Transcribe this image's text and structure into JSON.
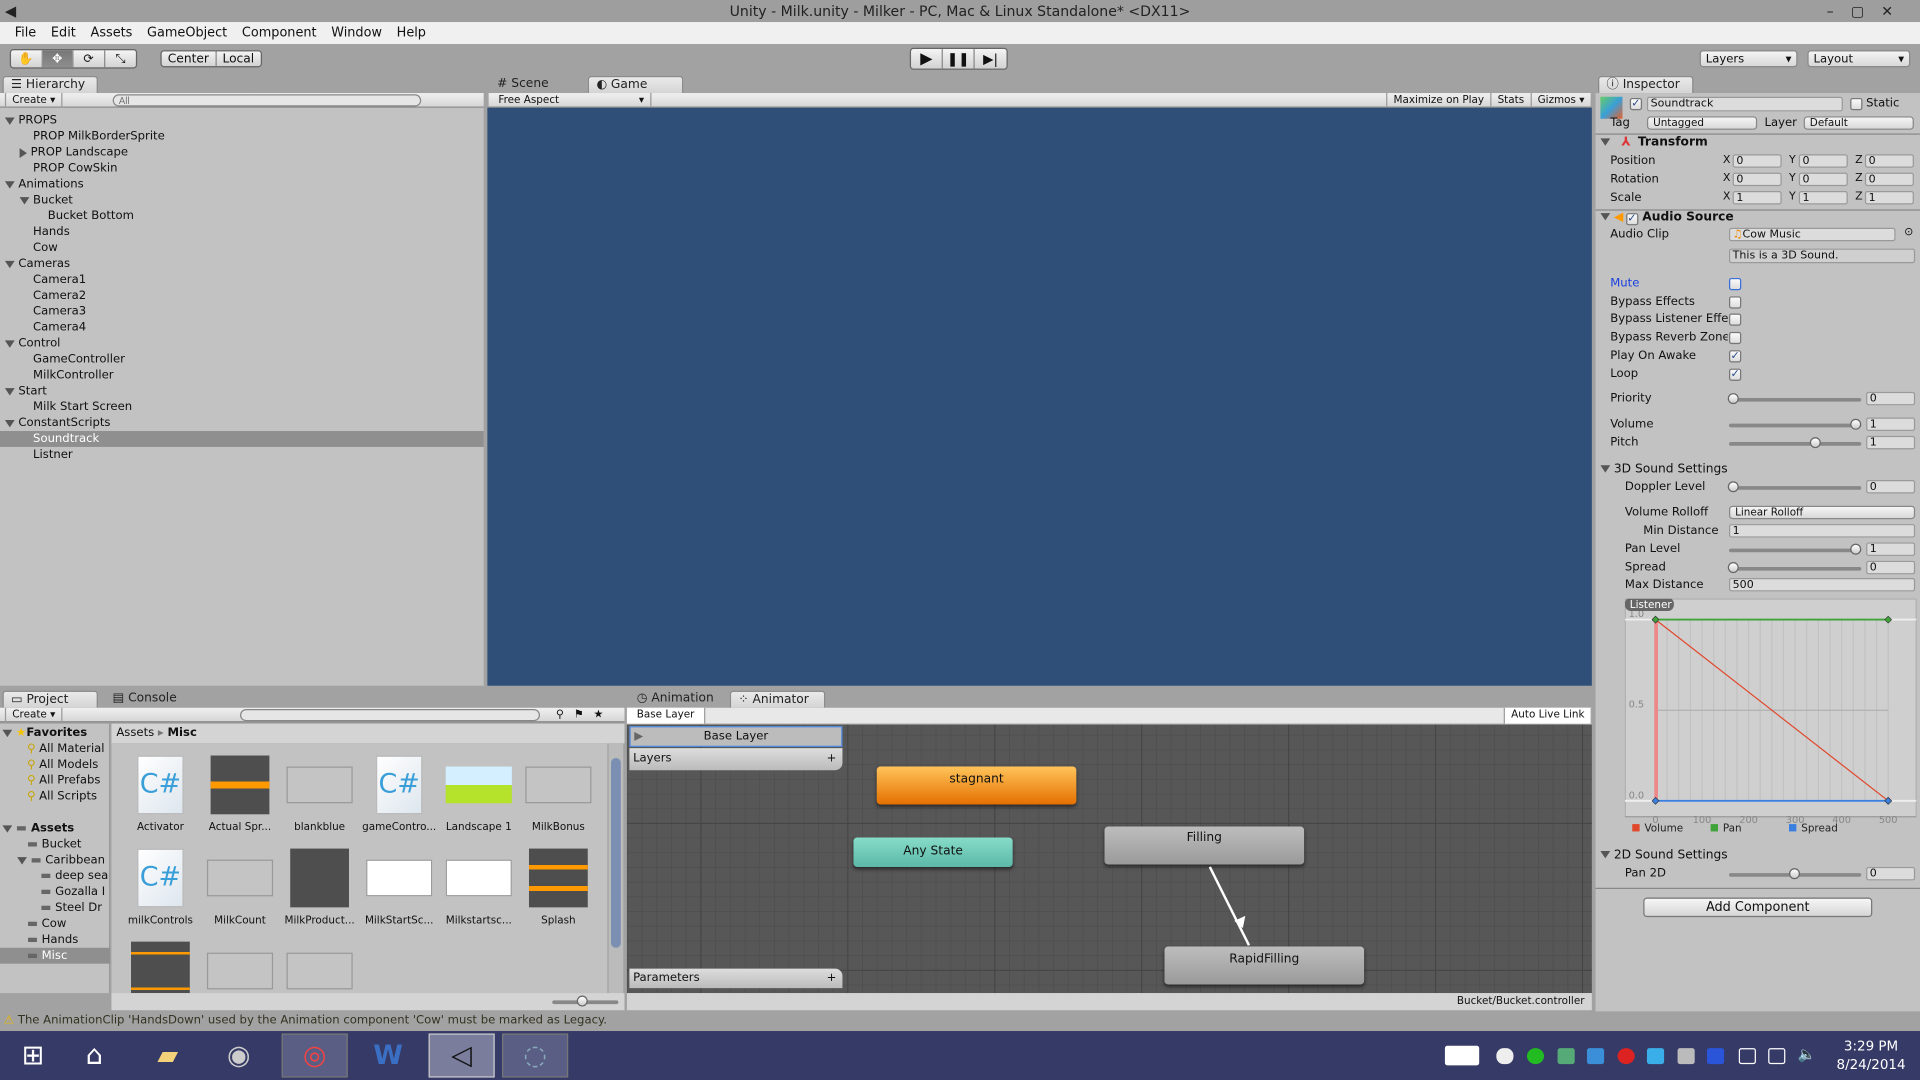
{
  "window": {
    "title": "Unity - Milk.unity - Milker - PC, Mac & Linux Standalone* <DX11>"
  },
  "menu": [
    "File",
    "Edit",
    "Assets",
    "GameObject",
    "Component",
    "Window",
    "Help"
  ],
  "toolbar": {
    "pivot": "Center",
    "space": "Local",
    "layers": "Layers",
    "layout": "Layout"
  },
  "hierarchy": {
    "tab": "Hierarchy",
    "create": "Create",
    "search_placeholder": "All",
    "items": [
      {
        "label": "PROPS",
        "level": 0,
        "arrow": "down"
      },
      {
        "label": "PROP MilkBorderSprite",
        "level": 1
      },
      {
        "label": "PROP Landscape",
        "level": 1,
        "arrow": "right"
      },
      {
        "label": "PROP CowSkin",
        "level": 1
      },
      {
        "label": "Animations",
        "level": 0,
        "arrow": "down"
      },
      {
        "label": "Bucket",
        "level": 1,
        "arrow": "down"
      },
      {
        "label": "Bucket Bottom",
        "level": 2
      },
      {
        "label": "Hands",
        "level": 1
      },
      {
        "label": "Cow",
        "level": 1
      },
      {
        "label": "Cameras",
        "level": 0,
        "arrow": "down"
      },
      {
        "label": "Camera1",
        "level": 1
      },
      {
        "label": "Camera2",
        "level": 1
      },
      {
        "label": "Camera3",
        "level": 1
      },
      {
        "label": "Camera4",
        "level": 1
      },
      {
        "label": "Control",
        "level": 0,
        "arrow": "down"
      },
      {
        "label": "GameController",
        "level": 1
      },
      {
        "label": "MilkController",
        "level": 1
      },
      {
        "label": "Start",
        "level": 0,
        "arrow": "down"
      },
      {
        "label": "Milk Start Screen",
        "level": 1
      },
      {
        "label": "ConstantScripts",
        "level": 0,
        "arrow": "down"
      },
      {
        "label": "Soundtrack",
        "level": 1,
        "selected": true
      },
      {
        "label": "Listner",
        "level": 1
      }
    ]
  },
  "scene": {
    "tabs": [
      "Scene",
      "Game"
    ],
    "aspect": "Free Aspect",
    "buttons": [
      "Maximize on Play",
      "Stats",
      "Gizmos"
    ],
    "bg_color": "#2f4f78"
  },
  "inspector": {
    "tab": "Inspector",
    "name": "Soundtrack",
    "static": "Static",
    "tag_label": "Tag",
    "tag": "Untagged",
    "layer_label": "Layer",
    "layer": "Default",
    "transform": {
      "title": "Transform",
      "rows": [
        {
          "label": "Position",
          "x": "0",
          "y": "0",
          "z": "0"
        },
        {
          "label": "Rotation",
          "x": "0",
          "y": "0",
          "z": "0"
        },
        {
          "label": "Scale",
          "x": "1",
          "y": "1",
          "z": "1"
        }
      ]
    },
    "audio": {
      "title": "Audio Source",
      "clip_label": "Audio Clip",
      "clip": "Cow Music",
      "note": "This is a 3D Sound.",
      "checks": [
        {
          "label": "Mute",
          "checked": false,
          "highlight": true
        },
        {
          "label": "Bypass Effects",
          "checked": false
        },
        {
          "label": "Bypass Listener Effe",
          "checked": false
        },
        {
          "label": "Bypass Reverb Zone",
          "checked": false
        },
        {
          "label": "Play On Awake",
          "checked": true
        },
        {
          "label": "Loop",
          "checked": true
        }
      ],
      "sliders": [
        {
          "label": "Priority",
          "value": "0",
          "fraction": 0
        },
        {
          "label": "Volume",
          "value": "1",
          "fraction": 1
        },
        {
          "label": "Pitch",
          "value": "1",
          "fraction": 0.67
        }
      ],
      "sound3d": {
        "title": "3D Sound Settings",
        "doppler_label": "Doppler Level",
        "doppler": "0",
        "doppler_fraction": 0,
        "rolloff_label": "Volume Rolloff",
        "rolloff": "Linear Rolloff",
        "min_label": "Min Distance",
        "min": "1",
        "pan_label": "Pan Level",
        "pan": "1",
        "pan_fraction": 1,
        "spread_label": "Spread",
        "spread": "0",
        "spread_fraction": 0,
        "max_label": "Max Distance",
        "max": "500"
      },
      "sound2d": {
        "title": "2D Sound Settings",
        "pan2d_label": "Pan 2D",
        "pan2d": "0",
        "pan2d_fraction": 0.5
      }
    },
    "add_component": "Add Component"
  },
  "chart_data": {
    "type": "line",
    "title": "Listener",
    "xlim": [
      0,
      500
    ],
    "ylim": [
      0,
      1
    ],
    "xticks": [
      "0",
      "100",
      "200",
      "300",
      "400",
      "500"
    ],
    "yticks": [
      "0.0",
      "0.5",
      "1.0"
    ],
    "legend": "bottom",
    "series": [
      {
        "name": "Volume",
        "color": "#e0482c",
        "x": [
          0,
          500
        ],
        "y": [
          1,
          0
        ]
      },
      {
        "name": "Pan",
        "color": "#3fa33a",
        "x": [
          0,
          500
        ],
        "y": [
          1,
          1
        ]
      },
      {
        "name": "Spread",
        "color": "#3a7fe0",
        "x": [
          0,
          500
        ],
        "y": [
          0,
          0
        ]
      }
    ]
  },
  "project": {
    "tabs": [
      "Project",
      "Console"
    ],
    "create": "Create",
    "favorites_label": "Favorites",
    "favorites": [
      "All Material",
      "All Models",
      "All Prefabs",
      "All Scripts"
    ],
    "assets_label": "Assets",
    "folders": [
      {
        "label": "Bucket",
        "level": 1
      },
      {
        "label": "Caribbean",
        "level": 1,
        "arrow": "down"
      },
      {
        "label": "deep sea",
        "level": 2
      },
      {
        "label": "Gozalla I",
        "level": 2
      },
      {
        "label": "Steel Dr",
        "level": 2
      },
      {
        "label": "Cow",
        "level": 1
      },
      {
        "label": "Hands",
        "level": 1
      },
      {
        "label": "Misc",
        "level": 1,
        "selected": true
      }
    ],
    "breadcrumb": [
      "Assets",
      "Misc"
    ],
    "assets": [
      {
        "label": "Activator",
        "kind": "script"
      },
      {
        "label": "Actual Spr...",
        "kind": "audio"
      },
      {
        "label": "blankblue",
        "kind": "anim"
      },
      {
        "label": "gameContro...",
        "kind": "script"
      },
      {
        "label": "Landscape 1",
        "kind": "landscape"
      },
      {
        "label": "MilkBonus",
        "kind": "anim"
      },
      {
        "label": "milkControls",
        "kind": "script"
      },
      {
        "label": "MilkCount",
        "kind": "anim"
      },
      {
        "label": "MilkProduct...",
        "kind": "dark"
      },
      {
        "label": "MilkStartSc...",
        "kind": "white"
      },
      {
        "label": "Milkstartsc...",
        "kind": "white"
      },
      {
        "label": "Splash",
        "kind": "audio2"
      },
      {
        "label": "",
        "kind": "audio3"
      },
      {
        "label": "",
        "kind": "anim"
      },
      {
        "label": "",
        "kind": "anim"
      }
    ]
  },
  "animator": {
    "tabs": [
      "Animation",
      "Animator"
    ],
    "breadcrumb": "Base Layer",
    "auto_live": "Auto Live Link",
    "layer": "Base Layer",
    "layers_label": "Layers",
    "params_label": "Parameters",
    "states": [
      "stagnant",
      "Any State",
      "Filling",
      "RapidFilling"
    ],
    "path": "Bucket/Bucket.controller"
  },
  "status": "The AnimationClip 'HandsDown' used by the Animation component 'Cow' must be marked as Legacy.",
  "taskbar": {
    "time": "3:29 PM",
    "date": "8/24/2014"
  }
}
